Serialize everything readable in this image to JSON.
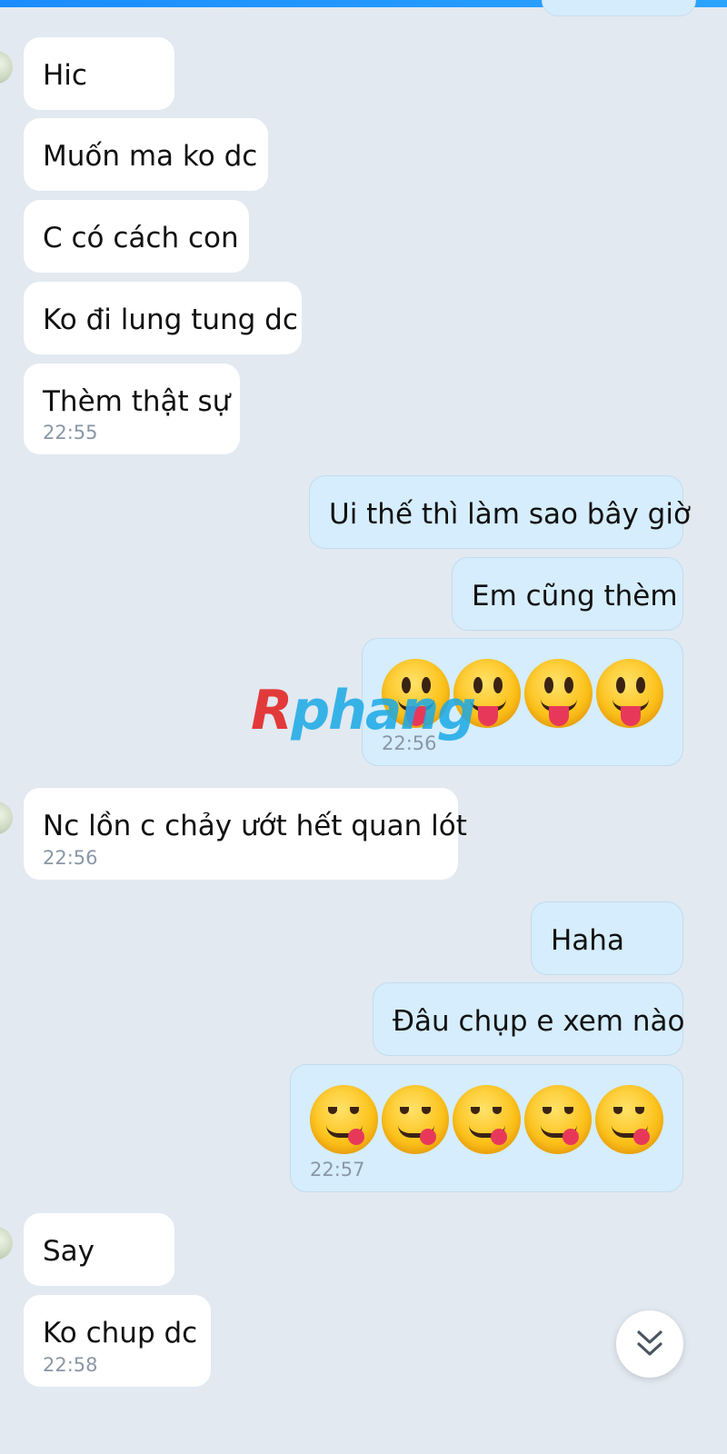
{
  "messages": [
    {
      "side": "in",
      "text": "Hic"
    },
    {
      "side": "in",
      "text": "Muốn ma ko dc"
    },
    {
      "side": "in",
      "text": "C có cách con"
    },
    {
      "side": "in",
      "text": "Ko đi lung tung dc"
    },
    {
      "side": "in",
      "text": "Thèm thật sự",
      "time": "22:55"
    },
    {
      "side": "out",
      "text": "Ui thế thì làm sao bây giờ"
    },
    {
      "side": "out",
      "text": "Em cũng thèm"
    },
    {
      "side": "out",
      "emoji": "stuck-out-tongue-face",
      "emoji_count": 4,
      "time": "22:56"
    },
    {
      "side": "in",
      "text": "Nc lồn c chảy ướt hết quan lót",
      "time": "22:56"
    },
    {
      "side": "out",
      "text": "Haha"
    },
    {
      "side": "out",
      "text": "Đâu chụp e xem nào"
    },
    {
      "side": "out",
      "emoji": "face-savoring-food",
      "emoji_count": 5,
      "time": "22:57"
    },
    {
      "side": "in",
      "text": "Say"
    },
    {
      "side": "in",
      "text": "Ko chup dc",
      "time": "22:58"
    }
  ],
  "watermark": {
    "first": "R",
    "rest": "phang"
  },
  "scroll_down_icon": "double-chevron-down-icon",
  "colors": {
    "background": "#e2e9f1",
    "incoming": "#ffffff",
    "outgoing": "#d5edfc",
    "accent": "#1a8cff"
  }
}
